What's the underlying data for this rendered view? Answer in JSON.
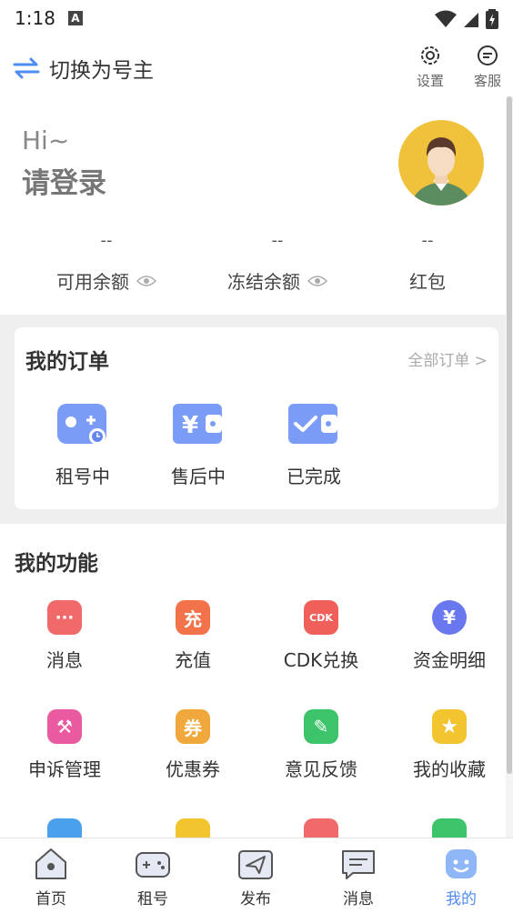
{
  "status_bar": {
    "time": "1:18",
    "notif_letter": "A"
  },
  "header": {
    "switch_label": "切换为号主",
    "settings_label": "设置",
    "service_label": "客服"
  },
  "profile": {
    "greeting": "Hi~",
    "login_prompt": "请登录",
    "stats": [
      {
        "value": "--",
        "label": "可用余额"
      },
      {
        "value": "--",
        "label": "冻结余额"
      },
      {
        "value": "--",
        "label": "红包"
      }
    ]
  },
  "orders": {
    "title": "我的订单",
    "all_link": "全部订单 >",
    "items": [
      {
        "label": "租号中",
        "icon": "gamepad-clock-icon"
      },
      {
        "label": "售后中",
        "icon": "yen-wallet-icon"
      },
      {
        "label": "已完成",
        "icon": "check-wallet-icon"
      }
    ]
  },
  "functions": {
    "title": "我的功能",
    "items": [
      {
        "label": "消息",
        "icon": "message-icon",
        "glyph": "···",
        "color": "#f06a6a"
      },
      {
        "label": "充值",
        "icon": "recharge-icon",
        "glyph": "充",
        "color": "#f2734a"
      },
      {
        "label": "CDK兑换",
        "icon": "cdk-icon",
        "glyph": "CDK",
        "color": "#f0605a"
      },
      {
        "label": "资金明细",
        "icon": "funds-icon",
        "glyph": "¥",
        "color": "#6a78f0"
      },
      {
        "label": "申诉管理",
        "icon": "gavel-icon",
        "glyph": "⚒",
        "color": "#e95aa0"
      },
      {
        "label": "优惠券",
        "icon": "coupon-icon",
        "glyph": "券",
        "color": "#f0a83c"
      },
      {
        "label": "意见反馈",
        "icon": "feedback-icon",
        "glyph": "✎",
        "color": "#3dc46a"
      },
      {
        "label": "我的收藏",
        "icon": "star-icon",
        "glyph": "★",
        "color": "#f2c42e"
      }
    ],
    "partial_row_colors": [
      "#4aa0ea",
      "#f2c42e",
      "#f06a6a",
      "#3dc46a"
    ]
  },
  "nav": {
    "items": [
      {
        "label": "首页",
        "icon": "home-icon"
      },
      {
        "label": "租号",
        "icon": "gamepad-icon"
      },
      {
        "label": "发布",
        "icon": "paper-plane-icon"
      },
      {
        "label": "消息",
        "icon": "chat-icon"
      },
      {
        "label": "我的",
        "icon": "smiley-icon"
      }
    ],
    "active_color": "#4f8cf2"
  }
}
